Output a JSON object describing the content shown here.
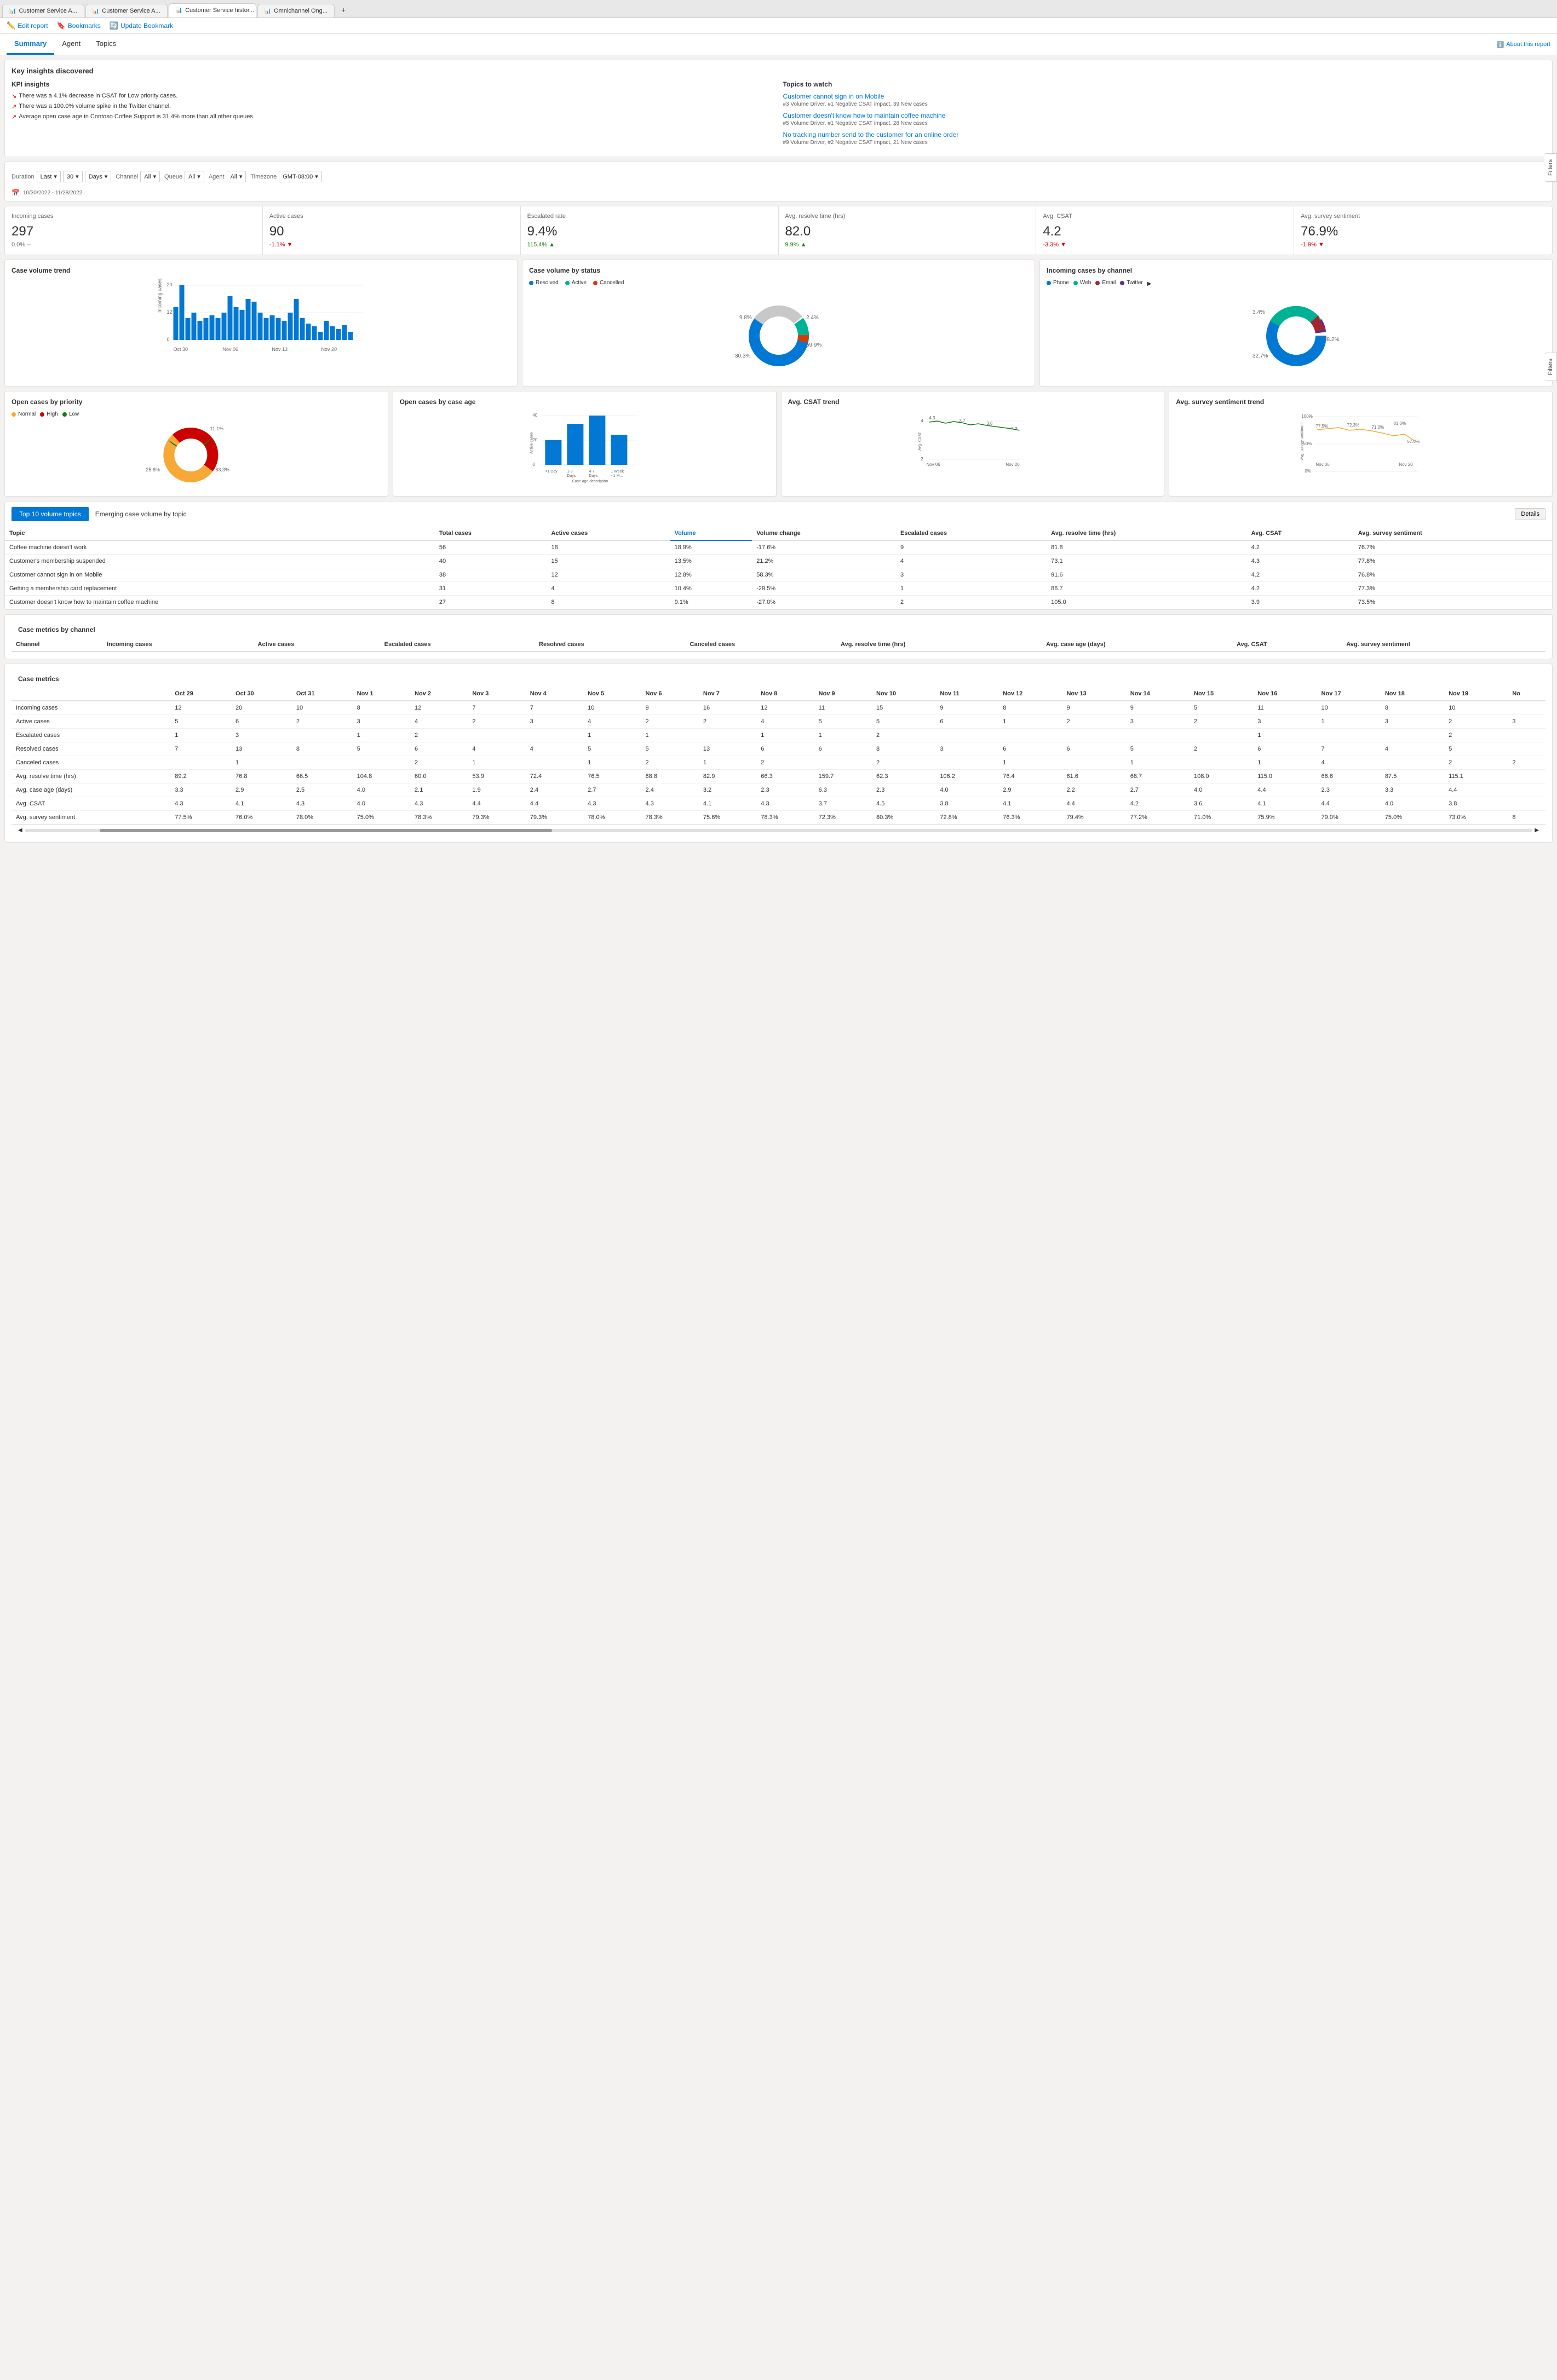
{
  "browser": {
    "tabs": [
      {
        "label": "Customer Service A...",
        "active": false,
        "id": "tab1"
      },
      {
        "label": "Customer Service A...",
        "active": false,
        "id": "tab2"
      },
      {
        "label": "Customer Service histor...",
        "active": true,
        "id": "tab3"
      },
      {
        "label": "Omnichannel Ong...",
        "active": false,
        "id": "tab4"
      }
    ]
  },
  "toolbar": {
    "edit_report": "Edit report",
    "bookmarks": "Bookmarks",
    "update_bookmark": "Update Bookmark",
    "about_link": "About this report"
  },
  "nav": {
    "tabs": [
      "Summary",
      "Agent",
      "Topics"
    ],
    "active": "Summary"
  },
  "key_insights": {
    "title": "Key insights discovered",
    "kpi_title": "KPI insights",
    "insights": [
      "There was a 4.1% decrease in CSAT for Low priority cases.",
      "There was a 100.0% volume spike in the Twitter channel.",
      "Average open case age in Contoso Coffee Support is 31.4% more than all other queues."
    ],
    "topics_title": "Topics to watch",
    "topics": [
      {
        "label": "Customer cannot sign in on Mobile",
        "meta": "#3 Volume Driver, #1 Negative CSAT impact, 39 New cases"
      },
      {
        "label": "Customer doesn't know how to maintain coffee machine",
        "meta": "#5 Volume Driver, #1 Negative CSAT impact, 28 New cases"
      },
      {
        "label": "No tracking number send to the customer for an online order",
        "meta": "#9 Volume Driver, #2 Negative CSAT impact, 21 New cases"
      }
    ]
  },
  "filters": {
    "duration_label": "Duration",
    "duration_preset": "Last",
    "duration_value": "30",
    "duration_unit": "Days",
    "channel_label": "Channel",
    "channel_value": "All",
    "queue_label": "Queue",
    "queue_value": "All",
    "agent_label": "Agent",
    "agent_value": "All",
    "timezone_label": "Timezone",
    "timezone_value": "GMT-08:00",
    "date_range": "10/30/2022 - 11/28/2022"
  },
  "kpis": [
    {
      "title": "Incoming cases",
      "value": "297",
      "change": "0.0%",
      "trend": "neutral",
      "suffix": "--"
    },
    {
      "title": "Active cases",
      "value": "90",
      "change": "-1.1%",
      "trend": "down"
    },
    {
      "title": "Escalated rate",
      "value": "9.4%",
      "change": "115.4%",
      "trend": "up"
    },
    {
      "title": "Avg. resolve time (hrs)",
      "value": "82.0",
      "change": "9.9%",
      "trend": "up"
    },
    {
      "title": "Avg. CSAT",
      "value": "4.2",
      "change": "-3.3%",
      "trend": "down"
    },
    {
      "title": "Avg. survey sentiment",
      "value": "76.9%",
      "change": "-1.9%",
      "trend": "down"
    }
  ],
  "case_volume_trend": {
    "title": "Case volume trend",
    "y_max": 20,
    "y_labels": [
      "20",
      "12",
      "0"
    ],
    "x_labels": [
      "Oct 30",
      "Nov 06",
      "Nov 13",
      "Nov 20"
    ],
    "bars": [
      12,
      20,
      8,
      10,
      7,
      8,
      9,
      8,
      10,
      16,
      12,
      11,
      14,
      13,
      10,
      8,
      9,
      8,
      7,
      10,
      15,
      8,
      6,
      5,
      3,
      7,
      4,
      3,
      5,
      2
    ]
  },
  "case_volume_status": {
    "title": "Case volume by status",
    "legend": [
      {
        "label": "Resolved",
        "color": "#0078d4"
      },
      {
        "label": "Active",
        "color": "#00b294"
      },
      {
        "label": "Cancelled",
        "color": "#d83b01"
      }
    ],
    "segments": [
      {
        "label": "59.9%",
        "pct": 59.9,
        "color": "#0078d4"
      },
      {
        "label": "9.8%",
        "pct": 9.8,
        "color": "#00b294"
      },
      {
        "label": "2.4%",
        "pct": 2.4,
        "color": "#d83b01"
      },
      {
        "label": "30.3%",
        "pct": 30.3,
        "color": "#c8c8c8"
      }
    ],
    "labels_outside": [
      "9.8%",
      "2.4%",
      "59.9%",
      "30.3%"
    ]
  },
  "incoming_by_channel": {
    "title": "Incoming cases by channel",
    "legend": [
      {
        "label": "Phone",
        "color": "#0078d4"
      },
      {
        "label": "Web",
        "color": "#00b294"
      },
      {
        "label": "Email",
        "color": "#a4262c"
      },
      {
        "label": "Twitter",
        "color": "#5c2d91"
      }
    ],
    "segments": [
      {
        "pct": 58.2,
        "color": "#0078d4"
      },
      {
        "pct": 32.7,
        "color": "#00b294"
      },
      {
        "pct": 3.4,
        "color": "#5c2d91"
      },
      {
        "pct": 5.7,
        "color": "#a4262c"
      }
    ],
    "labels": [
      "3.4%",
      "58.2%",
      "32.7%"
    ]
  },
  "open_cases_priority": {
    "title": "Open cases by priority",
    "legend": [
      {
        "label": "Normal",
        "color": "#f7a836"
      },
      {
        "label": "High",
        "color": "#c00"
      },
      {
        "label": "Low",
        "color": "#107c10"
      }
    ],
    "segments": [
      {
        "pct": 63.3,
        "color": "#f7a836"
      },
      {
        "pct": 25.6,
        "color": "#a4262c"
      },
      {
        "pct": 11.1,
        "color": "#107c10"
      }
    ],
    "labels": [
      "11.1%",
      "25.6%",
      "63.3%"
    ]
  },
  "open_cases_age": {
    "title": "Open cases by case age",
    "bars": [
      {
        "label": "<1 Day",
        "value": 18
      },
      {
        "label": "1-3 Days",
        "value": 30
      },
      {
        "label": "4-7 Days",
        "value": 38
      },
      {
        "label": "1 Week - 1 M...",
        "value": 22
      }
    ],
    "y_label": "Active cases",
    "x_label": "Case age description",
    "y_max": 40
  },
  "avg_csat_trend": {
    "title": "Avg. CSAT trend",
    "points_label": [
      "4.3",
      "3.7",
      "3.6",
      "3.3"
    ],
    "x_labels": [
      "Nov 06",
      "Nov 20"
    ],
    "y_labels": [
      "4",
      "2"
    ]
  },
  "avg_survey_sentiment_trend": {
    "title": "Avg. survey sentiment trend",
    "points_label": [
      "77.5%",
      "72.3%",
      "71.0%",
      "81.0%",
      "57.0%"
    ],
    "x_labels": [
      "Nov 06",
      "Nov 20"
    ],
    "y_labels": [
      "100%",
      "50%",
      "0%"
    ]
  },
  "top10_topics": {
    "title": "Top 10 volume topics",
    "emerging_label": "Emerging case volume by topic",
    "details_label": "Details",
    "columns": [
      "Topic",
      "Total cases",
      "Active cases",
      "Volume",
      "Volume change",
      "Escalated cases",
      "Avg. resolve time (hrs)",
      "Avg. CSAT",
      "Avg. survey sentiment"
    ],
    "rows": [
      {
        "topic": "Coffee machine doesn't work",
        "total": 56,
        "active": 18,
        "volume": "18.9%",
        "vol_change": "-17.6%",
        "escalated": 9,
        "resolve": "81.8",
        "csat": "4.2",
        "sentiment": "76.7%"
      },
      {
        "topic": "Customer's membership suspended",
        "total": 40,
        "active": 15,
        "volume": "13.5%",
        "vol_change": "21.2%",
        "escalated": 4,
        "resolve": "73.1",
        "csat": "4.3",
        "sentiment": "77.8%"
      },
      {
        "topic": "Customer cannot sign in on Mobile",
        "total": 38,
        "active": 12,
        "volume": "12.8%",
        "vol_change": "58.3%",
        "escalated": 3,
        "resolve": "91.6",
        "csat": "4.2",
        "sentiment": "76.8%"
      },
      {
        "topic": "Getting a membership card replacement",
        "total": 31,
        "active": 4,
        "volume": "10.4%",
        "vol_change": "-29.5%",
        "escalated": 1,
        "resolve": "86.7",
        "csat": "4.2",
        "sentiment": "77.3%"
      },
      {
        "topic": "Customer doesn't know how to maintain coffee machine",
        "total": 27,
        "active": 8,
        "volume": "9.1%",
        "vol_change": "-27.0%",
        "escalated": 2,
        "resolve": "105.0",
        "csat": "3.9",
        "sentiment": "73.5%"
      }
    ]
  },
  "case_metrics_channel": {
    "title": "Case metrics by channel",
    "columns": [
      "Channel",
      "Incoming cases",
      "Active cases",
      "Escalated cases",
      "Resolved cases",
      "Canceled cases",
      "Avg. resolve time (hrs)",
      "Avg. case age (days)",
      "Avg. CSAT",
      "Avg. survey sentiment"
    ]
  },
  "case_metrics": {
    "title": "Case metrics",
    "date_cols": [
      "Oct 29",
      "Oct 30",
      "Oct 31",
      "Nov 1",
      "Nov 2",
      "Nov 3",
      "Nov 4",
      "Nov 5",
      "Nov 6",
      "Nov 7",
      "Nov 8",
      "Nov 9",
      "Nov 10",
      "Nov 11",
      "Nov 12",
      "Nov 13",
      "Nov 14",
      "Nov 15",
      "Nov 16",
      "Nov 17",
      "Nov 18",
      "Nov 19",
      "No"
    ],
    "rows": [
      {
        "label": "Incoming cases",
        "values": [
          "12",
          "20",
          "10",
          "8",
          "12",
          "7",
          "7",
          "10",
          "9",
          "16",
          "12",
          "11",
          "15",
          "9",
          "8",
          "9",
          "9",
          "5",
          "11",
          "10",
          "8",
          "10",
          ""
        ]
      },
      {
        "label": "Active cases",
        "values": [
          "5",
          "6",
          "2",
          "3",
          "4",
          "2",
          "3",
          "4",
          "2",
          "2",
          "4",
          "5",
          "5",
          "6",
          "1",
          "2",
          "3",
          "2",
          "3",
          "1",
          "3",
          "2",
          "3"
        ]
      },
      {
        "label": "Escalated cases",
        "values": [
          "1",
          "3",
          "",
          "1",
          "2",
          "",
          "",
          "1",
          "1",
          "",
          "1",
          "1",
          "2",
          "",
          "",
          "",
          "",
          "",
          "1",
          "",
          "",
          "2",
          ""
        ]
      },
      {
        "label": "Resolved cases",
        "values": [
          "7",
          "13",
          "8",
          "5",
          "6",
          "4",
          "4",
          "5",
          "5",
          "13",
          "6",
          "6",
          "8",
          "3",
          "6",
          "6",
          "5",
          "2",
          "6",
          "7",
          "4",
          "5",
          ""
        ]
      },
      {
        "label": "Canceled cases",
        "values": [
          "",
          "1",
          "",
          "",
          "2",
          "1",
          "",
          "1",
          "2",
          "1",
          "2",
          "",
          "2",
          "",
          "1",
          "",
          "1",
          "",
          "1",
          "4",
          "",
          "2",
          "2"
        ]
      },
      {
        "label": "Avg. resolve time (hrs)",
        "values": [
          "89.2",
          "76.8",
          "66.5",
          "104.8",
          "60.0",
          "53.9",
          "72.4",
          "76.5",
          "68.8",
          "82.9",
          "66.3",
          "159.7",
          "62.3",
          "106.2",
          "76.4",
          "61.6",
          "68.7",
          "108.0",
          "115.0",
          "66.6",
          "87.5",
          "115.1",
          ""
        ]
      },
      {
        "label": "Avg. case age (days)",
        "values": [
          "3.3",
          "2.9",
          "2.5",
          "4.0",
          "2.1",
          "1.9",
          "2.4",
          "2.7",
          "2.4",
          "3.2",
          "2.3",
          "6.3",
          "2.3",
          "4.0",
          "2.9",
          "2.2",
          "2.7",
          "4.0",
          "4.4",
          "2.3",
          "3.3",
          "4.4",
          ""
        ]
      },
      {
        "label": "Avg. CSAT",
        "values": [
          "4.3",
          "4.1",
          "4.3",
          "4.0",
          "4.3",
          "4.4",
          "4.4",
          "4.3",
          "4.3",
          "4.1",
          "4.3",
          "3.7",
          "4.5",
          "3.8",
          "4.1",
          "4.4",
          "4.2",
          "3.6",
          "4.1",
          "4.4",
          "4.0",
          "3.8",
          ""
        ]
      },
      {
        "label": "Avg. survey sentiment",
        "values": [
          "77.5%",
          "76.0%",
          "78.0%",
          "75.0%",
          "78.3%",
          "79.3%",
          "79.3%",
          "78.0%",
          "78.3%",
          "75.6%",
          "78.3%",
          "72.3%",
          "80.3%",
          "72.8%",
          "76.3%",
          "79.4%",
          "77.2%",
          "71.0%",
          "75.9%",
          "79.0%",
          "75.0%",
          "73.0%",
          "8"
        ]
      }
    ]
  },
  "side_filters": [
    "Filters",
    "Filters"
  ]
}
